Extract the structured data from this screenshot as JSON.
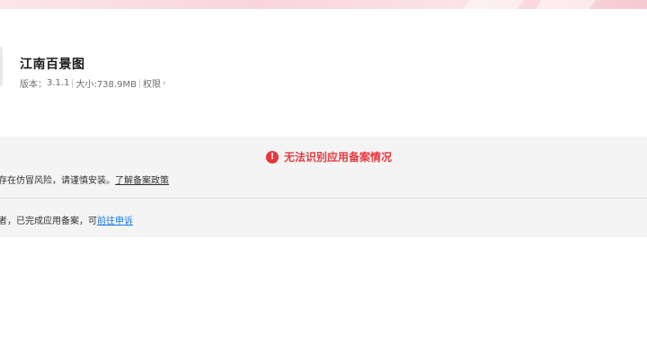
{
  "app": {
    "name": "江南百景图",
    "version_label": "版本：",
    "version": "3.1.1",
    "size": "大小:738.9MB",
    "permissions_label": "权限",
    "permissions_chevron": "›"
  },
  "notice": {
    "icon": "exclamation-circle-icon",
    "icon_glyph": "!",
    "title": "无法识别应用备案情况",
    "line1_text": "存在仿冒风险，请谨慎安装。",
    "line1_link": "了解备案政策",
    "line2_text": "者，已完成应用备案，可",
    "line2_link": "前往申诉",
    "colors": {
      "warning": "#e8383d",
      "link": "#1677e6"
    }
  }
}
